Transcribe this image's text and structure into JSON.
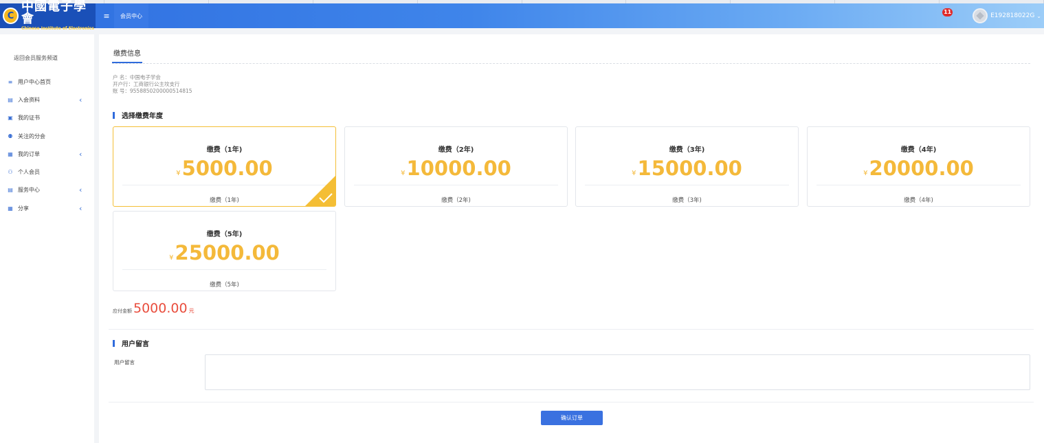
{
  "header": {
    "logo_cn": "中國電子學會",
    "logo_en": "Chinese Institute of Electronics",
    "menu_icon": "≡",
    "nav_tab": "会员中心",
    "notification_count": "11",
    "user_id": "E192818022G"
  },
  "sidebar": {
    "back_link": "返回会员服务频道",
    "items": [
      {
        "label": "用户中心首页",
        "icon": "list-icon",
        "glyph": "≡",
        "expandable": false
      },
      {
        "label": "入会资料",
        "icon": "profile-card-icon",
        "glyph": "▤",
        "expandable": true
      },
      {
        "label": "我的证书",
        "icon": "certificate-icon",
        "glyph": "▣",
        "expandable": false
      },
      {
        "label": "关注的分会",
        "icon": "group-icon",
        "glyph": "⚉",
        "expandable": false
      },
      {
        "label": "我的订单",
        "icon": "order-icon",
        "glyph": "▦",
        "expandable": true
      },
      {
        "label": "个人会员",
        "icon": "person-icon",
        "glyph": "⚇",
        "expandable": false
      },
      {
        "label": "服务中心",
        "icon": "service-icon",
        "glyph": "▤",
        "expandable": true
      },
      {
        "label": "分享",
        "icon": "share-icon",
        "glyph": "▦",
        "expandable": true
      }
    ],
    "chevron": "‹"
  },
  "main": {
    "section_title": "缴费信息",
    "account": {
      "name_line": "户 名：中国电子学会",
      "bank_line": "开户行：工商银行公主坟支行",
      "number_line": "账 号：9558850200000514815"
    },
    "year_section_title": "选择缴费年度",
    "currency_symbol": "¥",
    "plans": [
      {
        "title": "缴费（1年)",
        "price": "5000.00",
        "footer": "缴费（1年)",
        "selected": true
      },
      {
        "title": "缴费（2年)",
        "price": "10000.00",
        "footer": "缴费（2年)",
        "selected": false
      },
      {
        "title": "缴费（3年)",
        "price": "15000.00",
        "footer": "缴费（3年)",
        "selected": false
      },
      {
        "title": "缴费（4年)",
        "price": "20000.00",
        "footer": "缴费（4年)",
        "selected": false
      },
      {
        "title": "缴费（5年)",
        "price": "25000.00",
        "footer": "缴费（5年)",
        "selected": false
      }
    ],
    "due": {
      "label": "应付金额",
      "amount": "5000.00",
      "unit": "元"
    },
    "message_section_title": "用户留言",
    "message_label": "用户留言",
    "message_value": "",
    "confirm_button": "确认订单"
  },
  "colors": {
    "accent": "#2f6bdc",
    "price": "#f4b93a",
    "due": "#e94d3d",
    "selected_border": "#f4be35"
  }
}
